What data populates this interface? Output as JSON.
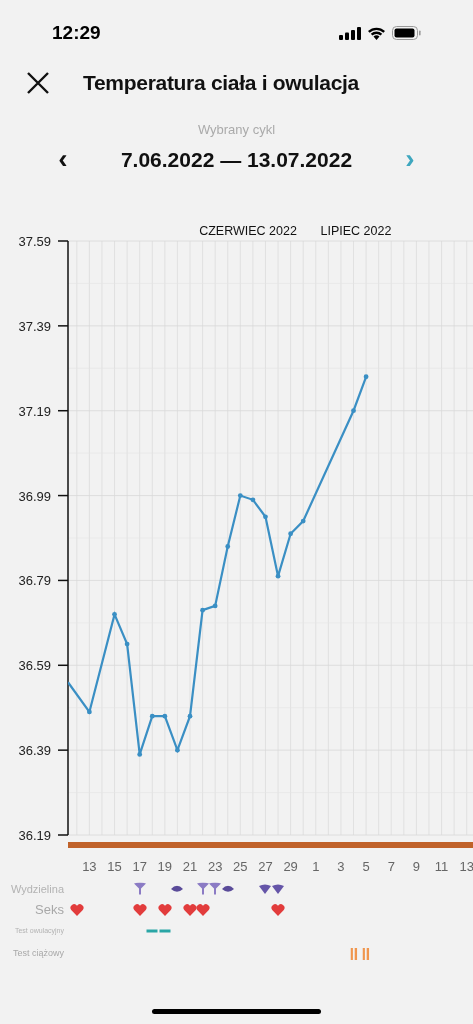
{
  "status_bar": {
    "time": "12:29"
  },
  "header": {
    "title": "Temperatura ciała i owulacja"
  },
  "cycle": {
    "caption": "Wybrany cykl",
    "range": "7.06.2022 — 13.07.2022",
    "prev": "‹",
    "next": "›"
  },
  "months": [
    "CZERWIEC 2022",
    "LIPIEC 2022"
  ],
  "chart_data": {
    "type": "line",
    "grid": true,
    "xlim": [
      11.3,
      43.5
    ],
    "ylim": [
      36.19,
      37.59
    ],
    "yticks": [
      36.19,
      36.39,
      36.59,
      36.79,
      36.99,
      37.19,
      37.39,
      37.59
    ],
    "xticks": [
      13,
      15,
      17,
      19,
      21,
      23,
      25,
      27,
      29
    ],
    "x": [
      11.3,
      13,
      15,
      16,
      17,
      18,
      19,
      20,
      21,
      22,
      23,
      24,
      25,
      26,
      27,
      28,
      29,
      30,
      34,
      35
    ],
    "series": [
      {
        "color": "#3a8fc4",
        "values": [
          36.55,
          36.48,
          36.71,
          36.64,
          36.38,
          36.47,
          36.47,
          36.39,
          36.47,
          36.72,
          36.73,
          36.87,
          36.99,
          36.98,
          36.94,
          36.8,
          36.9,
          36.93,
          37.19,
          37.27
        ]
      }
    ]
  },
  "july_day_labels": [
    "1",
    "3",
    "5",
    "7",
    "9",
    "11",
    "13"
  ],
  "rows": [
    {
      "label": "Wydzielina",
      "kind": "discharge",
      "markers": [
        {
          "kind": "cup"
        },
        {
          "kind": "lens"
        },
        {
          "kind": "cup"
        },
        {
          "kind": "cup"
        },
        {
          "kind": "lens"
        },
        {
          "kind": "drop"
        },
        {
          "kind": "drop"
        }
      ]
    },
    {
      "label": "Seks",
      "kind": "sex",
      "markers": [
        {
          "kind": "heart"
        },
        {
          "kind": "heart"
        },
        {
          "kind": "heart"
        },
        {
          "kind": "heart"
        },
        {
          "kind": "heart"
        },
        {
          "kind": "heart"
        }
      ]
    },
    {
      "label": "Test owulacyjny",
      "kind": "ovulation_test",
      "markers": [
        {
          "kind": "dash"
        },
        {
          "kind": "dash"
        }
      ]
    },
    {
      "label": "Test ciążowy",
      "kind": "pregnancy_test",
      "markers": [
        {
          "kind": "bars"
        },
        {
          "kind": "bars"
        }
      ]
    }
  ]
}
